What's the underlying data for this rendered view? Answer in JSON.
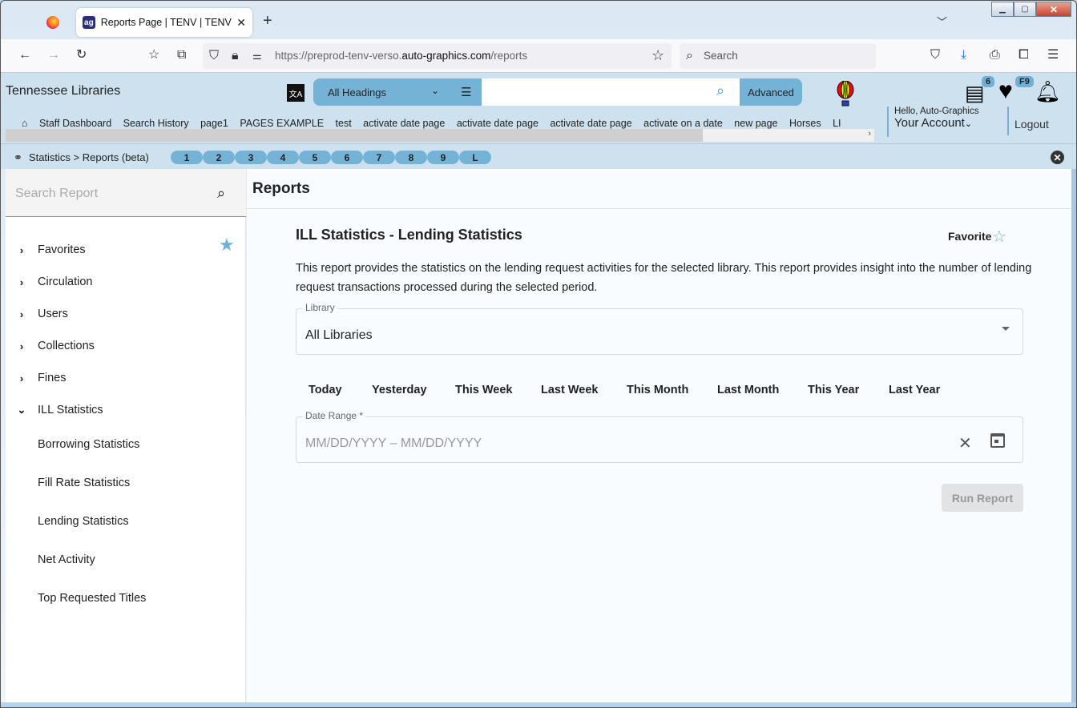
{
  "browser": {
    "tab_title": "Reports Page | TENV | TENV | Auto-Graphics",
    "tab_favicon_text": "ag",
    "new_tab": "+",
    "url_prefix": "https://preprod-tenv-verso.",
    "url_domain": "auto-graphics.com",
    "url_path": "/reports",
    "search_placeholder": "Search",
    "icons": [
      "back-icon",
      "forward-icon",
      "reload-icon",
      "bookmark-add-icon",
      "share-icon",
      "shield-icon",
      "lock-icon",
      "permissions-icon",
      "star-icon",
      "pocket-icon",
      "download-icon",
      "print-icon",
      "extensions-icon",
      "menu-icon"
    ]
  },
  "app": {
    "brand": "Tennessee Libraries",
    "search_scope": "All Headings",
    "search_value": "",
    "advanced_label": "Advanced",
    "list_badge": "6",
    "favorites_badge": "F9",
    "quick_links": [
      "Staff Dashboard",
      "Search History",
      "page1",
      "PAGES EXAMPLE",
      "test",
      "activate date page",
      "activate date page",
      "activate date page",
      "activate on a date",
      "new page",
      "Horses",
      "LI"
    ],
    "account_hello": "Hello, Auto-Graphics",
    "account_label": "Your Account",
    "logout_label": "Logout"
  },
  "breadcrumb": {
    "text": "Statistics > Reports (beta)",
    "pills": [
      "1",
      "2",
      "3",
      "4",
      "5",
      "6",
      "7",
      "8",
      "9",
      "L"
    ]
  },
  "sidebar": {
    "search_placeholder": "Search Report",
    "items": [
      {
        "label": "Favorites",
        "expanded": false
      },
      {
        "label": "Circulation",
        "expanded": false
      },
      {
        "label": "Users",
        "expanded": false
      },
      {
        "label": "Collections",
        "expanded": false
      },
      {
        "label": "Fines",
        "expanded": false
      },
      {
        "label": "ILL Statistics",
        "expanded": true
      }
    ],
    "subitems": [
      "Borrowing Statistics",
      "Fill Rate Statistics",
      "Lending Statistics",
      "Net Activity",
      "Top Requested Titles"
    ]
  },
  "main": {
    "header": "Reports",
    "report_title": "ILL Statistics - Lending Statistics",
    "favorite_label": "Favorite",
    "description": "This report provides the statistics on the lending request activities for the selected library. This report provides insight into the number of lending request transactions processed during the selected period.",
    "library_label": "Library",
    "library_value": "All Libraries",
    "quick_ranges": [
      "Today",
      "Yesterday",
      "This Week",
      "Last Week",
      "This Month",
      "Last Month",
      "This Year",
      "Last Year"
    ],
    "date_range_label": "Date Range *",
    "date_range_placeholder": "MM/DD/YYYY – MM/DD/YYYY",
    "run_label": "Run Report"
  }
}
